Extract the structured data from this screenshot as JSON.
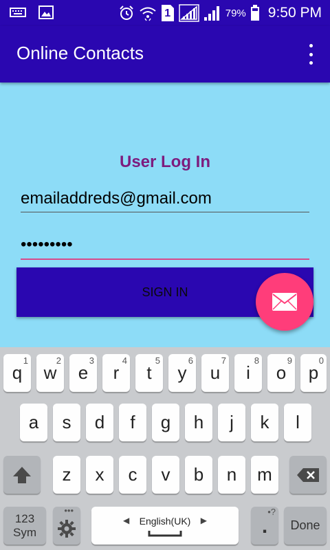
{
  "status_bar": {
    "battery_percent": "79%",
    "time": "9:50 PM",
    "sim_label": "1",
    "icons": [
      "keyboard-icon",
      "image-icon",
      "alarm-icon",
      "wifi-icon",
      "sim-icon",
      "signal-icon",
      "signal-icon",
      "battery-icon"
    ]
  },
  "app_bar": {
    "title": "Online Contacts",
    "overflow_icon": "more-vert-icon"
  },
  "login": {
    "title": "User Log In",
    "email_value": "emailaddreds@gmail.com",
    "password_value": "•••••••••",
    "signin_label": "SIGN IN",
    "fab_icon": "email-icon"
  },
  "keyboard": {
    "row1": [
      {
        "main": "q",
        "hint": "1"
      },
      {
        "main": "w",
        "hint": "2"
      },
      {
        "main": "e",
        "hint": "3"
      },
      {
        "main": "r",
        "hint": "4"
      },
      {
        "main": "t",
        "hint": "5"
      },
      {
        "main": "y",
        "hint": "6"
      },
      {
        "main": "u",
        "hint": "7"
      },
      {
        "main": "i",
        "hint": "8"
      },
      {
        "main": "o",
        "hint": "9"
      },
      {
        "main": "p",
        "hint": "0"
      }
    ],
    "row2": [
      "a",
      "s",
      "d",
      "f",
      "g",
      "h",
      "j",
      "k",
      "l"
    ],
    "row3": [
      "z",
      "x",
      "c",
      "v",
      "b",
      "n",
      "m"
    ],
    "sym_line1": "123",
    "sym_line2": "Sym",
    "language": "English(UK)",
    "period_key": ".",
    "period_hint": "•?",
    "settings_hint": "•••",
    "done_label": "Done"
  },
  "colors": {
    "primary": "#2a07b0",
    "background": "#8ddcf7",
    "accent": "#ff3d7a",
    "title": "#7d1c7e",
    "underline": "#d84a8a"
  }
}
